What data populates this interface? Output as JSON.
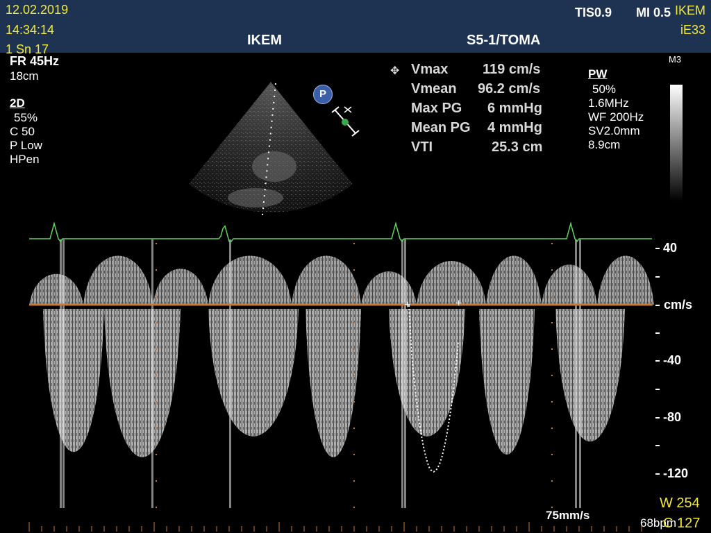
{
  "header": {
    "date": "12.02.2019",
    "time": "14:34:14",
    "study_id": "1 Sn 17",
    "institution": "IKEM",
    "probe_preset": "S5-1/TOMA",
    "tis": "TIS0.9",
    "mi": "MI 0.5",
    "site": "IKEM",
    "system": "iE33"
  },
  "left_params": {
    "frame_rate": "FR 45Hz",
    "depth": "18cm",
    "mode_2d": "2D",
    "gain_2d": "55%",
    "compression": "C 50",
    "power": "P Low",
    "harmonic": "HPen"
  },
  "measurements": [
    {
      "label": "Vmax",
      "value": "119 cm/s"
    },
    {
      "label": "Vmean",
      "value": "96.2 cm/s"
    },
    {
      "label": "Max PG",
      "value": "6 mmHg"
    },
    {
      "label": "Mean PG",
      "value": "4 mmHg"
    },
    {
      "label": "VTI",
      "value": "25.3 cm"
    }
  ],
  "pw_params": {
    "mode": "PW",
    "gain": "50%",
    "frequency": "1.6MHz",
    "wall_filter": "WF 200Hz",
    "sample_volume": "SV2.0mm",
    "gate_depth": "8.9cm"
  },
  "colormap_label": "M3",
  "velocity_axis": {
    "unit": "cm/s",
    "labels": [
      "40",
      "-40",
      "-80",
      "-120"
    ]
  },
  "sweep_speed": "75mm/s",
  "heart_rate": "68bpm",
  "window": "W 254",
  "level": "C 127",
  "probe_marker": "P",
  "colors": {
    "header_bg": "#1e3352",
    "yellow_text": "#f2e83a",
    "ecg_trace": "#5fd35f",
    "baseline": "#c87a3a"
  }
}
